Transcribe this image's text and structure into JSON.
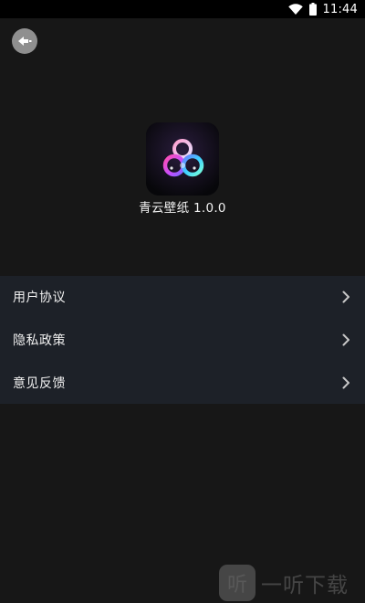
{
  "status_bar": {
    "time": "11:44",
    "icons": [
      "wifi-icon",
      "battery-icon"
    ]
  },
  "header": {
    "back_icon": "back-arrow-icon"
  },
  "about": {
    "app_name_version": "青云壁纸 1.0.0",
    "app_icon": "qingyun-wallpaper-app-icon"
  },
  "menu": {
    "items": [
      {
        "label": "用户协议",
        "icon": "chevron-right-icon"
      },
      {
        "label": "隐私政策",
        "icon": "chevron-right-icon"
      },
      {
        "label": "意见反馈",
        "icon": "chevron-right-icon"
      }
    ]
  },
  "watermark": {
    "logo_text": "听",
    "text": "一听下载"
  },
  "colors": {
    "background": "#171717",
    "status_bar": "#000000",
    "menu_background": "#1d2128",
    "back_button": "#8f8f8f"
  }
}
